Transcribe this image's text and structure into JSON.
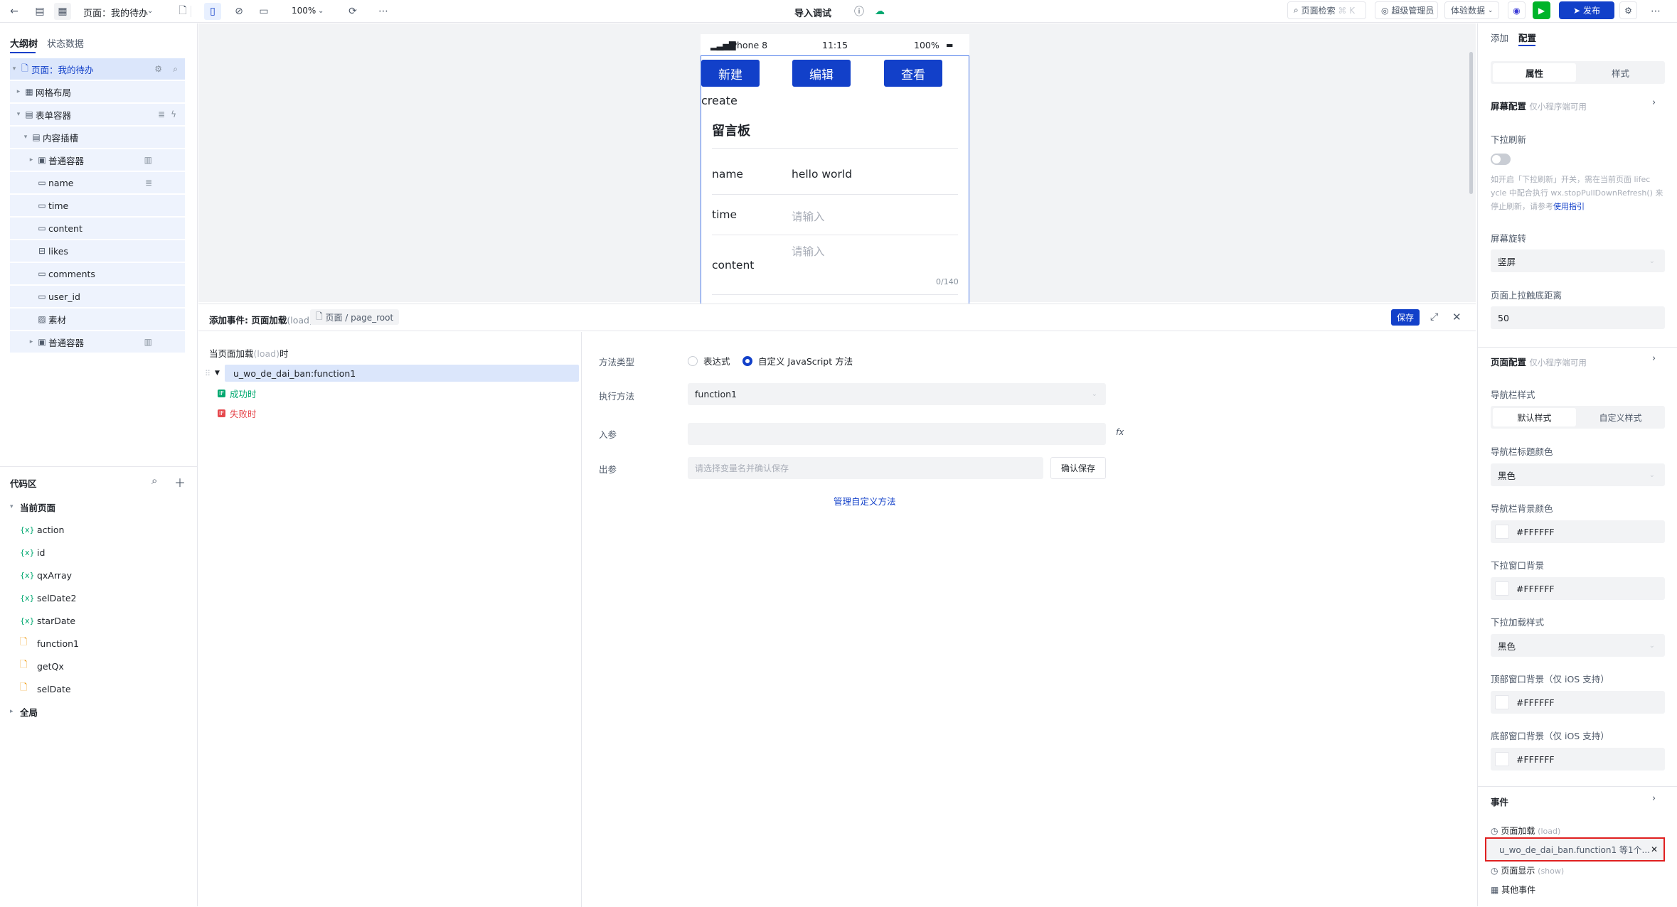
{
  "topbar": {
    "page_label": "页面：我的待办",
    "zoom": "100%",
    "title": "导入调试",
    "search_label": "页面检索",
    "search_shortcut": "⌘ K",
    "user_label": "超级管理员",
    "data_label": "体验数据",
    "publish_label": "发布"
  },
  "left": {
    "tab_outline": "大纲树",
    "tab_state": "状态数据",
    "tree": [
      {
        "label": "页面：我的待办"
      },
      {
        "label": "网格布局"
      },
      {
        "label": "表单容器"
      },
      {
        "label": "内容插槽"
      },
      {
        "label": "普通容器"
      },
      {
        "label": "name"
      },
      {
        "label": "time"
      },
      {
        "label": "content"
      },
      {
        "label": "likes"
      },
      {
        "label": "comments"
      },
      {
        "label": "user_id"
      },
      {
        "label": "素材"
      },
      {
        "label": "普通容器"
      }
    ],
    "code_title": "代码区",
    "current_page": "当前页面",
    "vars": [
      "action",
      "id",
      "qxArray",
      "selDate2",
      "starDate"
    ],
    "funcs": [
      "function1",
      "getQx",
      "selDate"
    ],
    "global": "全局"
  },
  "phone": {
    "device": "iPhone 8",
    "time": "11:15",
    "battery": "100%",
    "btn_new": "新建",
    "btn_edit": "编辑",
    "btn_view": "查看",
    "create_text": "create",
    "board_title": "留言板",
    "name_label": "name",
    "name_value": "hello world",
    "time_label": "time",
    "time_placeholder": "请输入",
    "content_label": "content",
    "content_placeholder": "请输入",
    "content_count": "0/140"
  },
  "event": {
    "header_prefix": "添加事件: 页面加载",
    "header_load": "(load)",
    "breadcrumb": "页面 / page_root",
    "save": "保存",
    "trigger_prefix": "当页面加载",
    "trigger_load": "(load)",
    "trigger_suffix": "时",
    "action_item": "u_wo_de_dai_ban:function1",
    "success": "成功时",
    "fail": "失败时",
    "method_type_label": "方法类型",
    "opt_expression": "表达式",
    "opt_custom": "自定义 JavaScript 方法",
    "exec_label": "执行方法",
    "exec_value": "function1",
    "input_label": "入参",
    "output_label": "出参",
    "output_placeholder": "请选择变量名并确认保存",
    "confirm_save": "确认保存",
    "manage_link": "管理自定义方法"
  },
  "right": {
    "tab_add": "添加",
    "tab_config": "配置",
    "seg_props": "属性",
    "seg_style": "样式",
    "screen_config": "屏幕配置",
    "mini_only": "仅小程序端可用",
    "pull_refresh": "下拉刷新",
    "pull_desc_1": "如开启「下拉刷新」开关，需在当前页面 lifec",
    "pull_desc_2": "ycle 中配合执行 wx.stopPullDownRefresh() 来",
    "pull_desc_3": "停止刷新，请参考",
    "usage_link": "使用指引",
    "rotate_label": "屏幕旋转",
    "rotate_value": "竖屏",
    "bottom_dist_label": "页面上拉触底距离",
    "bottom_dist_value": "50",
    "page_config": "页面配置",
    "page_mini_only": "仅小程序端可用",
    "nav_style_label": "导航栏样式",
    "nav_default": "默认样式",
    "nav_custom": "自定义样式",
    "nav_title_color_label": "导航栏标题颜色",
    "nav_title_color": "黑色",
    "nav_bg_label": "导航栏背景颜色",
    "nav_bg": "#FFFFFF",
    "pull_bg_label": "下拉窗口背景",
    "pull_bg": "#FFFFFF",
    "pull_load_label": "下拉加载样式",
    "pull_load": "黑色",
    "top_bg_label": "顶部窗口背景（仅 iOS 支持）",
    "top_bg": "#FFFFFF",
    "bottom_bg_label": "底部窗口背景（仅 iOS 支持）",
    "bottom_bg": "#FFFFFF",
    "events_title": "事件",
    "page_load": "页面加载",
    "page_load_tag": "(load)",
    "event_item": "u_wo_de_dai_ban.function1 等1个...",
    "page_show": "页面显示",
    "page_show_tag": "(show)",
    "other_events": "其他事件"
  }
}
